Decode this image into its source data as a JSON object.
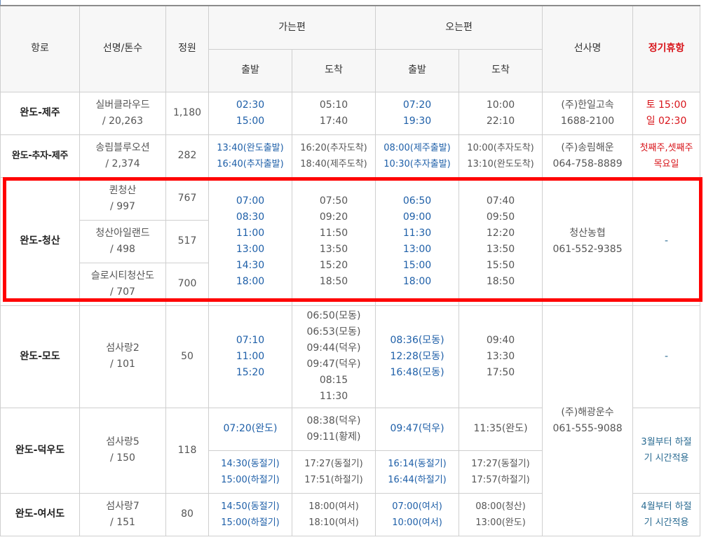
{
  "headers": {
    "route": "항로",
    "ship": "선명/톤수",
    "capacity": "정원",
    "outbound": "가는편",
    "inbound": "오는편",
    "depart": "출발",
    "arrive": "도착",
    "operator": "선사명",
    "holiday": "정기휴항"
  },
  "rows": {
    "jeju": {
      "route": "완도-제주",
      "ship": [
        "실버클라우드",
        "/ 20,263"
      ],
      "capacity": "1,180",
      "out_dep": [
        "02:30",
        "15:00"
      ],
      "out_arr": [
        "05:10",
        "17:40"
      ],
      "in_dep": [
        "07:20",
        "19:30"
      ],
      "in_arr": [
        "10:00",
        "22:10"
      ],
      "operator": [
        "(주)한일고속",
        "1688-2100"
      ],
      "holiday": [
        "토 15:00",
        "일 02:30"
      ]
    },
    "chuja": {
      "route": "완도-추자-제주",
      "ship": [
        "송림블루오션",
        "/ 2,374"
      ],
      "capacity": "282",
      "out_dep": [
        "13:40(완도출발)",
        "16:40(추자출발)"
      ],
      "out_arr": [
        "16:20(추자도착)",
        "18:40(제주도착)"
      ],
      "in_dep": [
        "08:00(제주출발)",
        "10:30(추자출발)"
      ],
      "in_arr": [
        "10:00(추자도착)",
        "13:10(완도도착)"
      ],
      "operator": [
        "(주)송림해운",
        "064-758-8889"
      ],
      "holiday": [
        "첫째주,셋째주",
        "목요일"
      ]
    },
    "cheongsan": {
      "route": "완도-청산",
      "ships": [
        {
          "name": "퀸청산",
          "tons": "/ 997",
          "capacity": "767"
        },
        {
          "name": "청산아일랜드",
          "tons": "/ 498",
          "capacity": "517"
        },
        {
          "name": "슬로시티청산도",
          "tons": "/ 707",
          "capacity": "700"
        }
      ],
      "out_dep": [
        "07:00",
        "08:30",
        "11:00",
        "13:00",
        "14:30",
        "18:00"
      ],
      "out_arr": [
        "07:50",
        "09:20",
        "11:50",
        "13:50",
        "15:20",
        "18:50"
      ],
      "in_dep": [
        "06:50",
        "09:00",
        "11:30",
        "13:00",
        "15:00",
        "18:00"
      ],
      "in_arr": [
        "07:40",
        "09:50",
        "12:20",
        "13:50",
        "15:50",
        "18:50"
      ],
      "operator": [
        "청산농협",
        "061-552-9385"
      ],
      "holiday": "-"
    },
    "modo": {
      "route": "완도-모도",
      "ship": [
        "섬사랑2",
        "/ 101"
      ],
      "capacity": "50",
      "out_dep": [
        "07:10",
        "11:00",
        "15:20"
      ],
      "out_arr": [
        "06:50(모동)",
        "06:53(모동)",
        "09:44(덕우)",
        "09:47(덕우)",
        "08:15",
        "11:30"
      ],
      "in_dep": [
        "08:36(모동)",
        "12:28(모동)",
        "16:48(모동)"
      ],
      "in_arr": [
        "09:40",
        "13:30",
        "17:50"
      ],
      "holiday": "-"
    },
    "shared_operator": [
      "(주)해광운수",
      "061-555-9088"
    ],
    "deokwoo": {
      "route": "완도-덕우도",
      "ship": [
        "섬사랑5",
        "/ 150"
      ],
      "capacity": "118",
      "a_out_dep": [
        "07:20(완도)"
      ],
      "a_out_arr": [
        "08:38(덕우)",
        "09:11(황제)"
      ],
      "a_in_dep": [
        "09:47(덕우)"
      ],
      "a_in_arr": [
        "11:35(완도)"
      ],
      "b_out_dep": [
        "14:30(동절기)",
        "15:00(하절기)"
      ],
      "b_out_arr": [
        "17:27(동절기)",
        "17:51(하절기)"
      ],
      "b_in_dep": [
        "16:14(동절기)",
        "16:44(하절기)"
      ],
      "b_in_arr": [
        "17:27(동절기)",
        "17:57(하절기)"
      ],
      "holiday": [
        "3월부터 하절",
        "기 시간적용"
      ]
    },
    "yeoseo": {
      "route": "완도-여서도",
      "ship": [
        "섬사랑7",
        "/ 151"
      ],
      "capacity": "80",
      "out_dep": [
        "14:50(동절기)",
        "15:00(하절기)"
      ],
      "out_arr": [
        "18:00(여서)",
        "18:10(여서)"
      ],
      "in_dep": [
        "07:00(여서)",
        "10:00(여서)"
      ],
      "in_arr": [
        "08:00(청산)",
        "13:00(완도)"
      ],
      "holiday": [
        "4월부터 하절",
        "기 시간적용"
      ]
    }
  },
  "colors": {
    "highlight_border": "#ff0000",
    "departure_text": "#1e5fa8",
    "holiday_text": "#d8141a",
    "note_text": "#2a6b92"
  }
}
